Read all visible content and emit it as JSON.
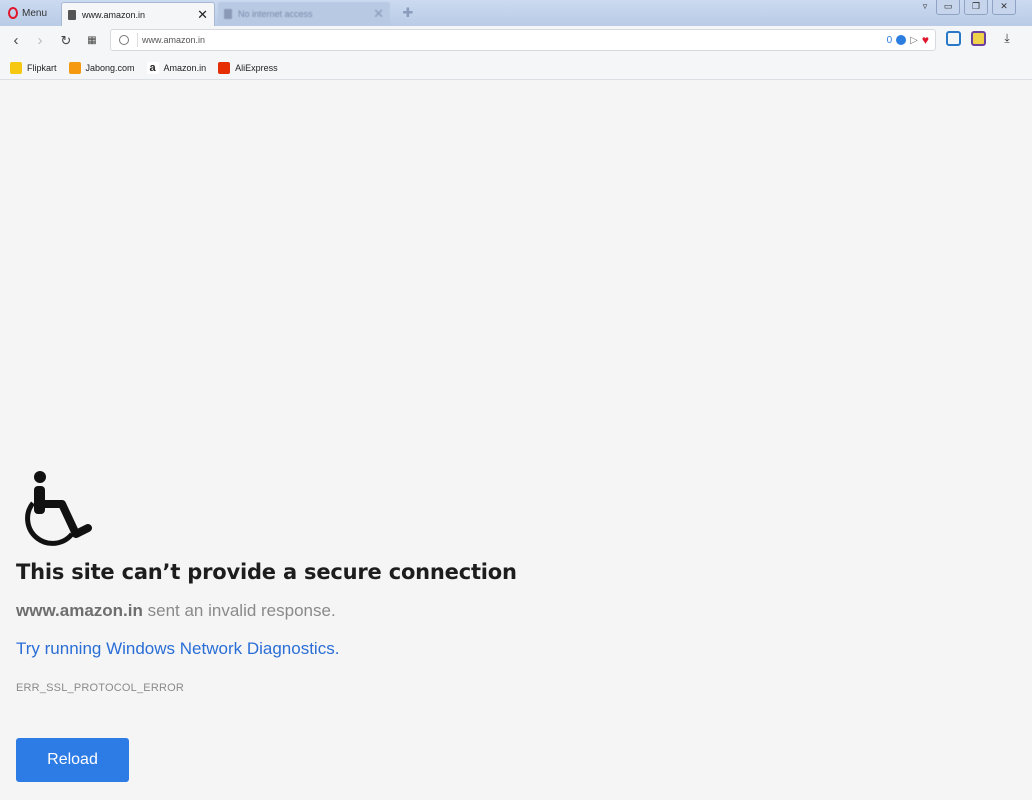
{
  "browser": {
    "menu_label": "Menu",
    "tabs": [
      {
        "title": "www.amazon.in",
        "active": true
      },
      {
        "title": "No internet access",
        "active": false
      }
    ],
    "address": "www.amazon.in",
    "address_badge_count": "0",
    "bookmarks": [
      {
        "label": "Flipkart",
        "color": "#f7c812"
      },
      {
        "label": "Jabong.com",
        "color": "#f59a10"
      },
      {
        "label": "Amazon.in",
        "color": "#222222"
      },
      {
        "label": "AliExpress",
        "color": "#e62e04"
      }
    ]
  },
  "error_page": {
    "icon": "wheelchair-icon",
    "title": "This site can’t provide a secure connection",
    "host": "www.amazon.in",
    "message_suffix": " sent an invalid response.",
    "diagnostics_link": "Try running Windows Network Diagnostics.",
    "error_code": "ERR_SSL_PROTOCOL_ERROR",
    "reload_label": "Reload"
  },
  "colors": {
    "accent": "#2d7be5",
    "link": "#2a6ed6",
    "opera_red": "#e0152b"
  }
}
